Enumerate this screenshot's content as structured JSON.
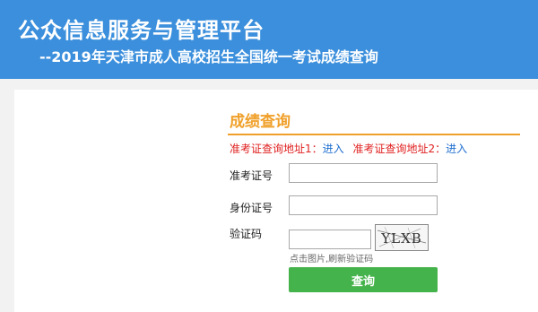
{
  "header": {
    "title": "公众信息服务与管理平台",
    "subtitle": "--2019年天津市成人高校招生全国统一考试成绩查询"
  },
  "query": {
    "section_title": "成绩查询",
    "addr1_label": "准考证查询地址1：",
    "addr1_link": "进入",
    "addr2_label": "准考证查询地址2：",
    "addr2_link": "进入",
    "exam_no_label": "准考证号",
    "exam_no_value": "",
    "id_label": "身份证号",
    "id_value": "",
    "captcha_label": "验证码",
    "captcha_value": "",
    "captcha_text": "YLXB",
    "captcha_hint": "点击图片,刷新验证码",
    "submit_label": "查询"
  },
  "colors": {
    "banner": "#3b8fdc",
    "accent": "#f0a02a",
    "warning_text": "#e02020",
    "link": "#1f6fd0",
    "button": "#45b34b"
  }
}
